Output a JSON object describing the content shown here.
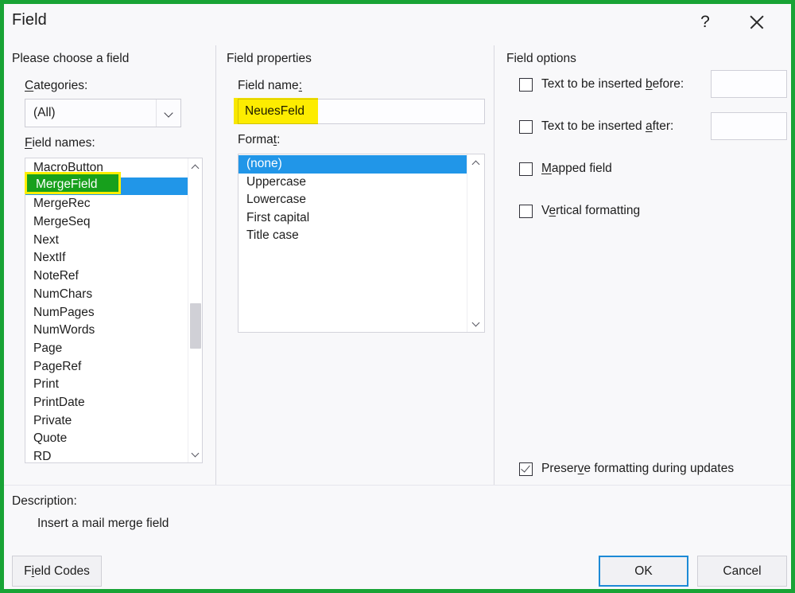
{
  "window": {
    "title": "Field",
    "help_icon": "question-mark-icon",
    "help_label": "?",
    "close_icon": "close-icon",
    "frame_accent_color": "#18a335"
  },
  "left_panel": {
    "header": "Please choose a field",
    "categories_label": "Categories:",
    "categories_accel": "C",
    "categories_value": "(All)",
    "field_names_label": "Field names:",
    "field_names_accel": "F",
    "field_names": [
      "MacroButton",
      "MergeField",
      "MergeRec",
      "MergeSeq",
      "Next",
      "NextIf",
      "NoteRef",
      "NumChars",
      "NumPages",
      "NumWords",
      "Page",
      "PageRef",
      "Print",
      "PrintDate",
      "Private",
      "Quote",
      "RD"
    ],
    "selected_field_name": "MergeField",
    "selected_index": 1,
    "selection_color": "#2196e8"
  },
  "middle_panel": {
    "header": "Field properties",
    "field_name_label": "Field name:",
    "field_name_accel": ":",
    "field_name_value": "NeuesFeld",
    "format_label": "Format:",
    "format_accel": "t",
    "format_options": [
      "(none)",
      "Uppercase",
      "Lowercase",
      "First capital",
      "Title case"
    ],
    "selected_format": "(none)",
    "selected_format_index": 0
  },
  "right_panel": {
    "header": "Field options",
    "options": [
      {
        "label_before": "Text to be inserted ",
        "label_accel": "b",
        "label_after": "efore:",
        "checked": false,
        "has_input": true,
        "input_value": ""
      },
      {
        "label_before": "Text to be inserted ",
        "label_accel": "a",
        "label_after": "fter:",
        "checked": false,
        "has_input": true,
        "input_value": ""
      },
      {
        "label_before": "",
        "label_accel": "M",
        "label_after": "apped field",
        "checked": false,
        "has_input": false,
        "input_value": ""
      },
      {
        "label_before": "V",
        "label_accel": "e",
        "label_after": "rtical formatting",
        "checked": false,
        "has_input": false,
        "input_value": ""
      }
    ],
    "preserve": {
      "label_before": "Preser",
      "label_accel": "v",
      "label_after": "e formatting during updates",
      "checked": true
    }
  },
  "description": {
    "label": "Description:",
    "text": "Insert a mail merge field"
  },
  "buttons": {
    "field_codes_before": "F",
    "field_codes_accel": "i",
    "field_codes_after": "eld Codes",
    "ok": "OK",
    "cancel": "Cancel",
    "default_button": "OK"
  },
  "annotations": {
    "field_name_highlight_color": "#ffee00",
    "merge_field_box_fill": "#17a01c",
    "merge_field_box_border": "#ffee00",
    "merge_field_box_label": "MergeField"
  }
}
